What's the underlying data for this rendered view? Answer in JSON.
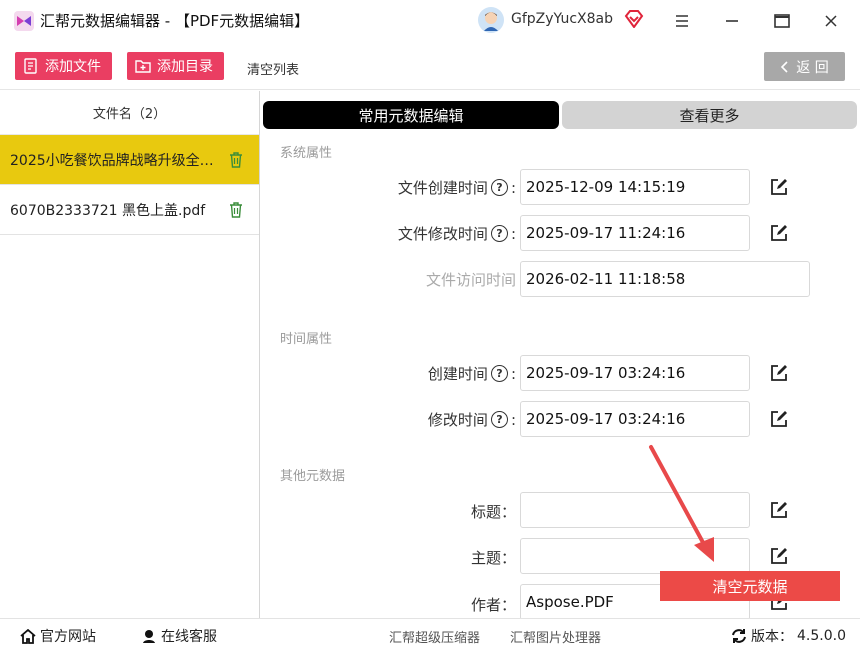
{
  "window": {
    "title": "汇帮元数据编辑器 - 【PDF元数据编辑】",
    "user_name": "GfpZyYucX8ab"
  },
  "toolbar": {
    "add_file": "添加文件",
    "add_folder": "添加目录",
    "clear_list": "清空列表",
    "back": "返 回"
  },
  "file_list": {
    "header": "文件名（2）",
    "items": [
      {
        "name": "2025小吃餐饮品牌战略升级全案...",
        "active": true
      },
      {
        "name": "6070B2333721 黑色上盖.pdf",
        "active": false
      }
    ]
  },
  "tabs": {
    "common": "常用元数据编辑",
    "more": "查看更多"
  },
  "sections": {
    "system": {
      "title": "系统属性",
      "created_label": "文件创建时间",
      "created_value": "2025-12-09 14:15:19",
      "modified_label": "文件修改时间",
      "modified_value": "2025-09-17 11:24:16",
      "accessed_label": "文件访问时间",
      "accessed_value": "2026-02-11 11:18:58"
    },
    "time": {
      "title": "时间属性",
      "created_label": "创建时间",
      "created_value": "2025-09-17 03:24:16",
      "modified_label": "修改时间",
      "modified_value": "2025-09-17 03:24:16"
    },
    "other": {
      "title": "其他元数据",
      "title_label": "标题：",
      "title_value": "",
      "subject_label": "主题：",
      "subject_value": "",
      "author_label": "作者：",
      "author_value": "Aspose.PDF"
    }
  },
  "colon": ":",
  "help_glyph": "?",
  "clear_metadata_button": "清空元数据",
  "bottom": {
    "website": "官方网站",
    "support": "在线客服",
    "compressor": "汇帮超级压缩器",
    "image_tool": "汇帮图片处理器",
    "version_label": "版本：",
    "version_value": "4.5.0.0"
  },
  "colors": {
    "accent_pink": "#ea3e62",
    "active_row": "#e8c90f",
    "clear_button": "#ec4a47",
    "arrow": "#e8494a"
  }
}
